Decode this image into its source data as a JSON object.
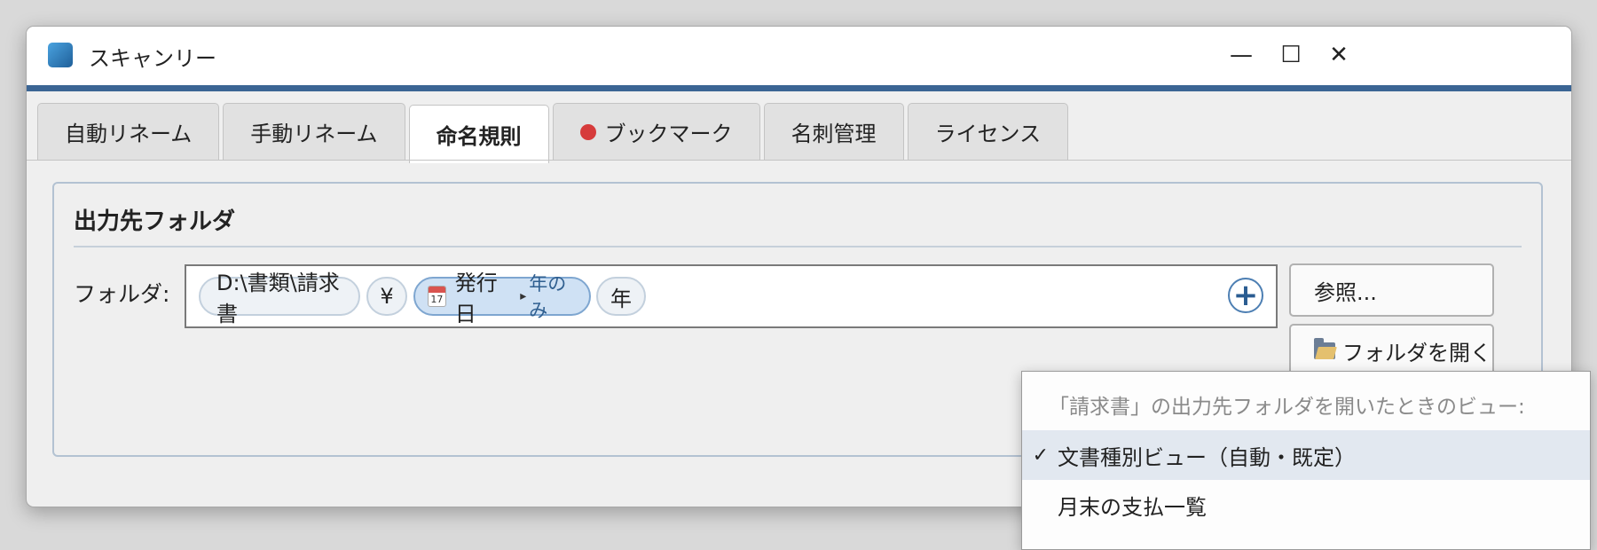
{
  "window": {
    "title": "スキャンリー",
    "controls": {
      "minimize": "—",
      "maximize": "☐",
      "close": "✕"
    }
  },
  "tabs": [
    {
      "label": "自動リネーム",
      "active": false
    },
    {
      "label": "手動リネーム",
      "active": false
    },
    {
      "label": "命名規則",
      "active": true
    },
    {
      "label": "ブックマーク",
      "active": false,
      "indicator_color": "#d63b3b"
    },
    {
      "label": "名刺管理",
      "active": false
    },
    {
      "label": "ライセンス",
      "active": false
    }
  ],
  "group": {
    "title": "出力先フォルダ",
    "folder_label": "フォルダ:",
    "chips": [
      {
        "text": "D:\\書類\\請求書"
      },
      {
        "text": "¥"
      },
      {
        "text": "発行日",
        "icon": "calendar-icon",
        "calendar_day": "17",
        "caret": "▸",
        "option": "年のみ"
      },
      {
        "text": "年"
      }
    ],
    "add_button": "+",
    "browse_button": "参照...",
    "open_folder_button": "フォルダを開く"
  },
  "dropdown": {
    "header": "「請求書」の出力先フォルダを開いたときのビュー:",
    "items": [
      {
        "label": "文書種別ビュー（自動・既定）",
        "checked": true,
        "check_mark": "✓"
      },
      {
        "label": "月末の支払一覧",
        "checked": false
      }
    ]
  },
  "colors": {
    "accent": "#3b6594",
    "bookmark_dot": "#d63b3b",
    "date_chip": "#cfe1f4"
  }
}
